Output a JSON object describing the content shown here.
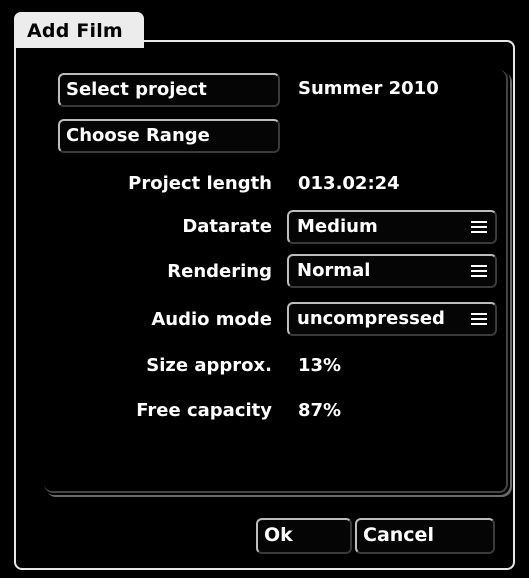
{
  "dialog": {
    "title": "Add Film"
  },
  "project": {
    "select_label": "Select project",
    "name": "Summer 2010",
    "range_label": "Choose Range"
  },
  "fields": {
    "project_length": {
      "label": "Project length",
      "value": "013.02:24"
    },
    "datarate": {
      "label": "Datarate",
      "value": "Medium"
    },
    "rendering": {
      "label": "Rendering",
      "value": "Normal"
    },
    "audio_mode": {
      "label": "Audio mode",
      "value": "uncompressed"
    },
    "size_approx": {
      "label": "Size approx.",
      "value": "13%"
    },
    "free_capacity": {
      "label": "Free capacity",
      "value": "87%"
    }
  },
  "footer": {
    "ok_label": "Ok",
    "cancel_label": "Cancel"
  },
  "icons": {
    "dropdown": "menu-icon"
  },
  "colors": {
    "background": "#000000",
    "text": "#ffffff",
    "tab_background": "#ececec",
    "tab_text": "#050505",
    "frame_border": "#e8e8e8"
  }
}
